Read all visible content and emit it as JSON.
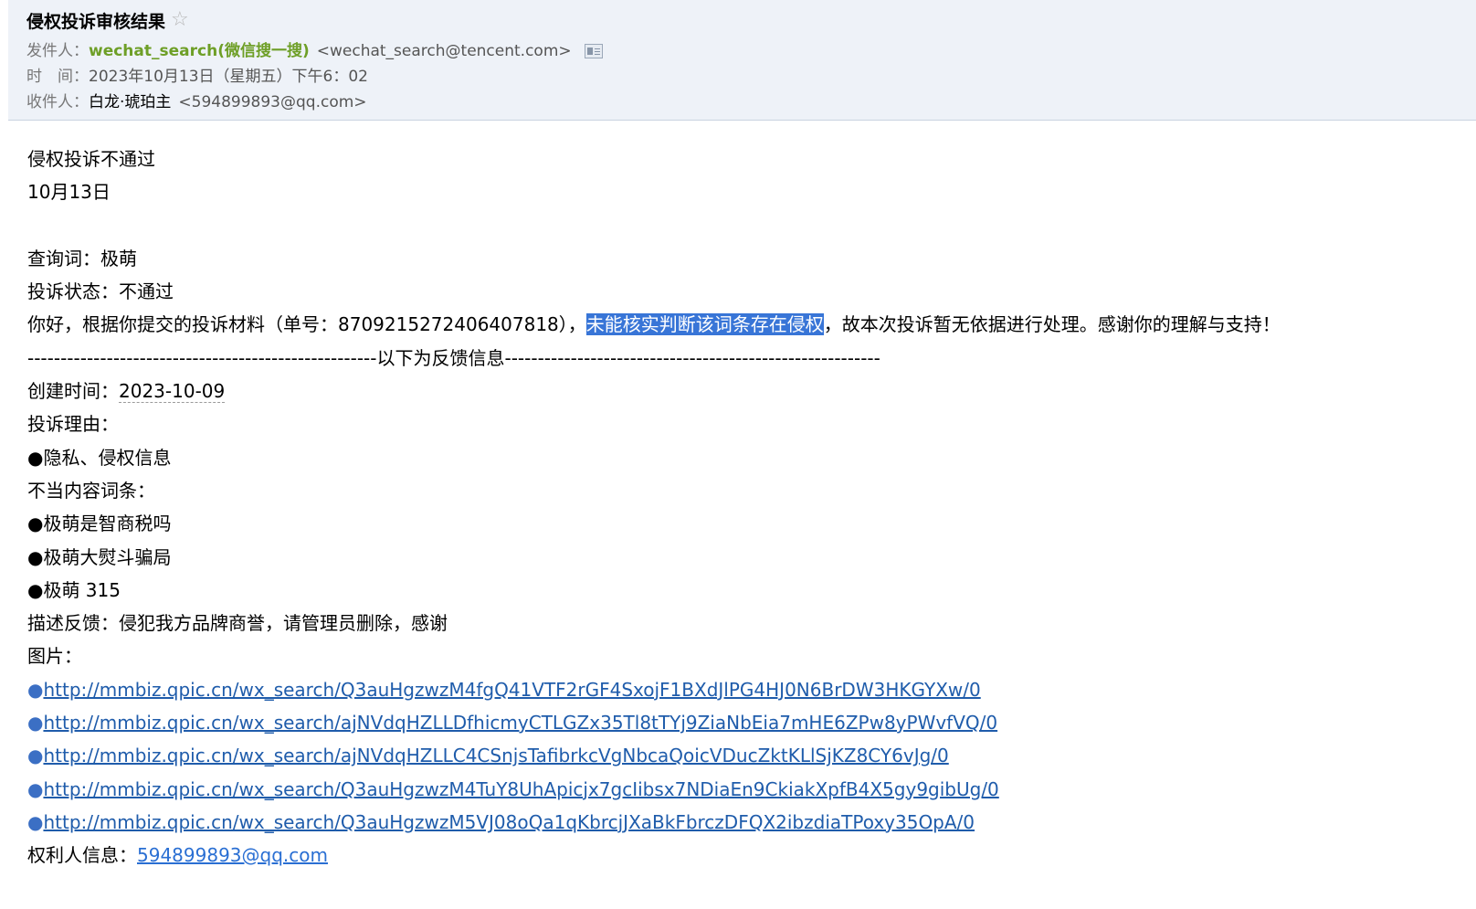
{
  "header": {
    "subject": "侵权投诉审核结果",
    "star_icon": "☆",
    "from_label": "发件人：",
    "from_name": "wechat_search(微信搜一搜)",
    "from_address": "<wechat_search@tencent.com>",
    "contact_icon": "contact-card-icon",
    "time_label": "时　间：",
    "time_value": "2023年10月13日（星期五）下午6：02",
    "to_label": "收件人：",
    "to_name": "白龙·琥珀主",
    "to_address": "<594899893@qq.com>"
  },
  "body": {
    "title": "侵权投诉不通过",
    "date": "10月13日",
    "query_line": "查询词：极萌",
    "status_line": "投诉状态：不通过",
    "message_pre": "你好，根据你提交的投诉材料（单号：8709215272406407818），",
    "message_highlight": "未能核实判断该词条存在侵权",
    "message_post": "，故本次投诉暂无依据进行处理。感谢你的理解与支持！",
    "divider": "-----------------------------------------------------以下为反馈信息---------------------------------------------------------",
    "created_label": "创建时间：",
    "created_value": "2023-10-09",
    "reason_label": "投诉理由：",
    "reason_item": "●隐私、侵权信息",
    "entries_label": "不当内容词条：",
    "entries": [
      "●极萌是智商税吗",
      "●极萌大熨斗骗局",
      "●极萌 315"
    ],
    "feedback_line": "描述反馈：侵犯我方品牌商誉，请管理员删除，感谢",
    "images_label": "图片：",
    "bullet": "●",
    "image_links": [
      "http://mmbiz.qpic.cn/wx_search/Q3auHgzwzM4fgQ41VTF2rGF4SxojF1BXdJlPG4HJ0N6BrDW3HKGYXw/0",
      "http://mmbiz.qpic.cn/wx_search/ajNVdqHZLLDfhicmyCTLGZx35Tl8tTYj9ZiaNbEia7mHE6ZPw8yPWvfVQ/0",
      "http://mmbiz.qpic.cn/wx_search/ajNVdqHZLLC4CSnjsTafibrkcVgNbcaQoicVDucZktKLlSjKZ8CY6vJg/0",
      "http://mmbiz.qpic.cn/wx_search/Q3auHgzwzM4TuY8UhApicjx7gcIibsx7NDiaEn9CkiakXpfB4X5gy9gibUg/0",
      "http://mmbiz.qpic.cn/wx_search/Q3auHgzwzM5VJ08oQa1qKbrcjJXaBkFbrczDFQX2ibzdiaTPoxy35OpA/0"
    ],
    "rights_label": "权利人信息：",
    "rights_email": "594899893@qq.com"
  }
}
